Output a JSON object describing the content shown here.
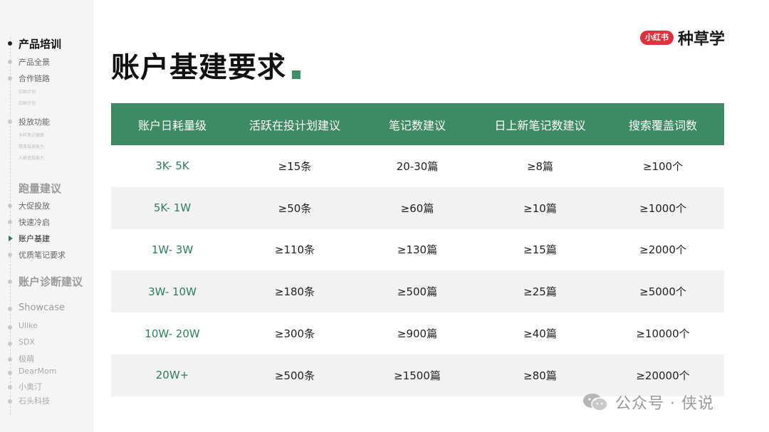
{
  "brand": {
    "badge": "小红书",
    "name": "种草学"
  },
  "title": "账户基建要求",
  "sidebar": {
    "sections": [
      {
        "label": "产品培训",
        "kind": "h1"
      },
      {
        "label": "产品全景",
        "kind": "sub"
      },
      {
        "label": "合作链路",
        "kind": "sub"
      },
      {
        "label": "红眼计划",
        "kind": "tiny"
      },
      {
        "label": "红眼计划",
        "kind": "tiny"
      },
      {
        "label": "投放功能",
        "kind": "sub"
      },
      {
        "label": "多样笔记展面",
        "kind": "tiny"
      },
      {
        "label": "精准投放能力",
        "kind": "tiny"
      },
      {
        "label": "人群追投能力",
        "kind": "tiny"
      },
      {
        "label": "跑量建议",
        "kind": "h1g"
      },
      {
        "label": "大促投放",
        "kind": "sub"
      },
      {
        "label": "快速冷启",
        "kind": "sub"
      },
      {
        "label": "账户基建",
        "kind": "cur"
      },
      {
        "label": "优质笔记要求",
        "kind": "sub"
      },
      {
        "label": "账户诊断建议",
        "kind": "h1g"
      },
      {
        "label": "Showcase",
        "kind": "h2g"
      },
      {
        "label": "Ulike",
        "kind": "subl"
      },
      {
        "label": "SDX",
        "kind": "subl"
      },
      {
        "label": "极萌",
        "kind": "subl"
      },
      {
        "label": "DearMom",
        "kind": "subl"
      },
      {
        "label": "小奥汀",
        "kind": "subl"
      },
      {
        "label": "石头科技",
        "kind": "subl"
      }
    ]
  },
  "table": {
    "headers": [
      "账户日耗量级",
      "活跃在投计划建议",
      "笔记数建议",
      "日上新笔记数建议",
      "搜索覆盖词数"
    ],
    "rows": [
      [
        "3K- 5K",
        "≥15条",
        "20-30篇",
        "≥8篇",
        "≥100个"
      ],
      [
        "5K- 1W",
        "≥50条",
        "≥60篇",
        "≥10篇",
        "≥1000个"
      ],
      [
        "1W- 3W",
        "≥110条",
        "≥130篇",
        "≥15篇",
        "≥2000个"
      ],
      [
        "3W- 10W",
        "≥180条",
        "≥500篇",
        "≥25篇",
        "≥5000个"
      ],
      [
        "10W- 20W",
        "≥300条",
        "≥900篇",
        "≥40篇",
        "≥10000个"
      ],
      [
        "20W+",
        "≥500条",
        "≥1500篇",
        "≥80篇",
        "≥20000个"
      ]
    ]
  },
  "watermark": {
    "text": "公众号 · 侠说",
    "icon": "wechat-icon"
  },
  "colors": {
    "accent": "#3e8a64",
    "brand_red": "#e0323c",
    "row_alt": "#f2f2f2"
  }
}
